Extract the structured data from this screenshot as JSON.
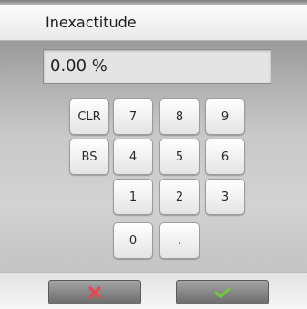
{
  "header": {
    "title": "Inexactitude"
  },
  "display": {
    "value": "0.00 %"
  },
  "keypad": {
    "clr": "CLR",
    "bs": "BS",
    "k7": "7",
    "k8": "8",
    "k9": "9",
    "k4": "4",
    "k5": "5",
    "k6": "6",
    "k1": "1",
    "k2": "2",
    "k3": "3",
    "k0": "0",
    "dot": "."
  },
  "footer": {
    "cancel_icon": "cancel-x-icon",
    "confirm_icon": "confirm-check-icon",
    "cancel_color": "#e8454e",
    "confirm_color": "#6ccc3a"
  }
}
